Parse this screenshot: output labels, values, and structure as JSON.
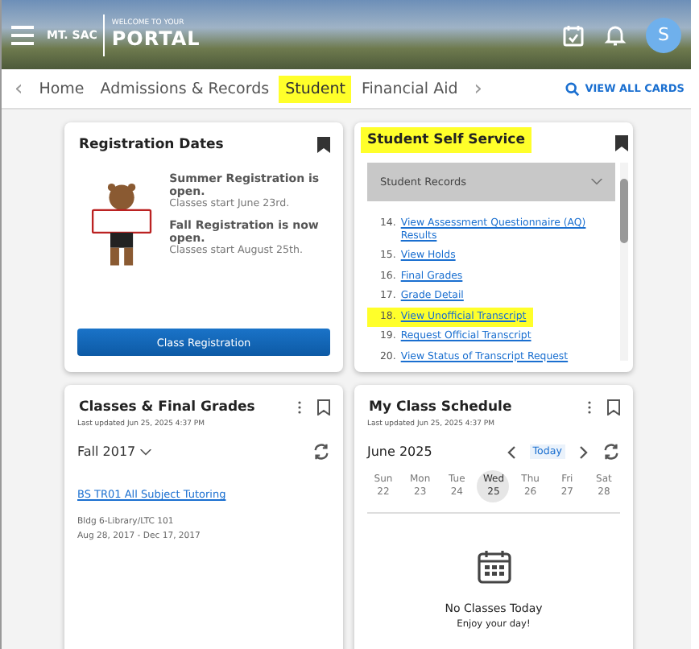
{
  "header": {
    "logo_small": "MT. SAC",
    "logo_caption": "WELCOME TO YOUR",
    "logo_title": "PORTAL",
    "avatar": "S"
  },
  "nav": {
    "prev": "‹",
    "next": "›",
    "tabs": [
      {
        "label": "Home",
        "selected": false
      },
      {
        "label": "Admissions & Records",
        "selected": false
      },
      {
        "label": "Student",
        "selected": true
      },
      {
        "label": "Financial Aid",
        "selected": false
      }
    ],
    "view_all": "VIEW ALL CARDS"
  },
  "registration": {
    "title": "Registration Dates",
    "notices": [
      {
        "heading": "Summer Registration is open.",
        "detail": "Classes start June 23rd."
      },
      {
        "heading": "Fall Registration is now open.",
        "detail": "Classes start August 25th."
      }
    ],
    "button": "Class Registration"
  },
  "self_service": {
    "title": "Student Self Service",
    "title_highlighted": true,
    "section": "Student Records",
    "links": [
      {
        "number": "14.",
        "label": "View Assessment Questionnaire (AQ) Results",
        "highlighted": false
      },
      {
        "number": "15.",
        "label": "View Holds",
        "highlighted": false
      },
      {
        "number": "16.",
        "label": "Final Grades",
        "highlighted": false
      },
      {
        "number": "17.",
        "label": "Grade Detail",
        "highlighted": false
      },
      {
        "number": "18.",
        "label": "View Unofficial Transcript",
        "highlighted": true
      },
      {
        "number": "19.",
        "label": "Request Official Transcript",
        "highlighted": false
      },
      {
        "number": "20.",
        "label": "View Status of Transcript Request",
        "highlighted": false
      }
    ]
  },
  "grades": {
    "title": "Classes & Final Grades",
    "updated": "Last updated Jun 25, 2025 4:37 PM",
    "term": "Fall 2017",
    "course": "BS TR01 All Subject Tutoring",
    "location": "Bldg 6-Library/LTC 101",
    "dates": "Aug 28, 2017 - Dec 17, 2017"
  },
  "schedule": {
    "title": "My Class Schedule",
    "updated": "Last updated Jun 25, 2025 4:37 PM",
    "month": "June 2025",
    "today": "Today",
    "days": [
      {
        "name": "Sun",
        "date": "22",
        "selected": false
      },
      {
        "name": "Mon",
        "date": "23",
        "selected": false
      },
      {
        "name": "Tue",
        "date": "24",
        "selected": false
      },
      {
        "name": "Wed",
        "date": "25",
        "selected": true
      },
      {
        "name": "Thu",
        "date": "26",
        "selected": false
      },
      {
        "name": "Fri",
        "date": "27",
        "selected": false
      },
      {
        "name": "Sat",
        "date": "28",
        "selected": false
      }
    ],
    "empty_title": "No Classes Today",
    "empty_subtitle": "Enjoy your day!"
  }
}
